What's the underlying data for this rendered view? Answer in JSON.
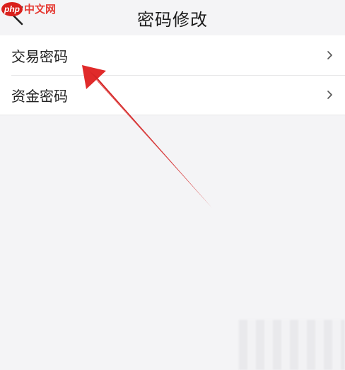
{
  "watermark": {
    "logo": "php",
    "text": "中文网"
  },
  "header": {
    "title": "密码修改"
  },
  "list": {
    "items": [
      {
        "label": "交易密码"
      },
      {
        "label": "资金密码"
      }
    ]
  },
  "colors": {
    "accent_red": "#e02a2a",
    "background": "#f4f4f6",
    "row_background": "#ffffff"
  }
}
